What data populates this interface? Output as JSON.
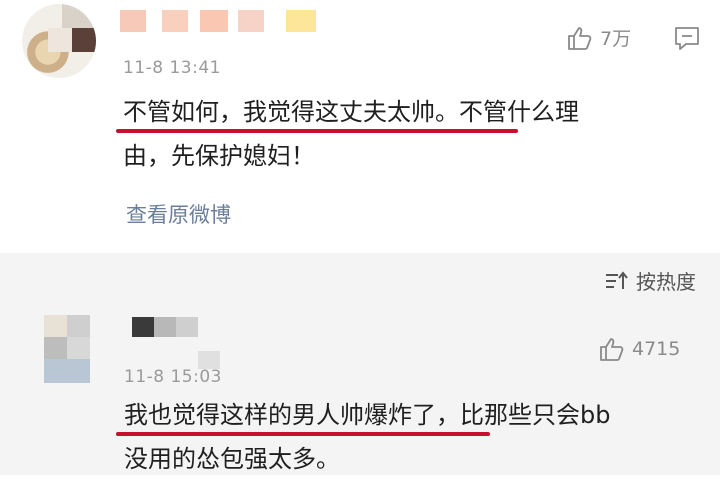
{
  "comments": [
    {
      "timestamp": "11-8 13:41",
      "likes": "7万",
      "highlighted_text": "不管如何，我觉得这丈夫太帅。",
      "text_line1_rest": "不管什么理",
      "text_line2": "由，先保护媳妇！",
      "view_original": "查看原微博"
    },
    {
      "timestamp": "11-8 15:03",
      "likes": "4715",
      "highlighted_text": "我也觉得这样的男人帅爆炸了，",
      "text_line1_rest": "比那些只会bb",
      "text_line2": "没用的怂包强太多。"
    }
  ],
  "sort": {
    "label": "按热度"
  },
  "colors": {
    "underline": "#c8102e",
    "link": "#6b7f99",
    "muted": "#9a9a9a"
  },
  "icons": {
    "like": "thumbs-up-icon",
    "reply": "comment-icon",
    "sort": "sort-icon"
  }
}
